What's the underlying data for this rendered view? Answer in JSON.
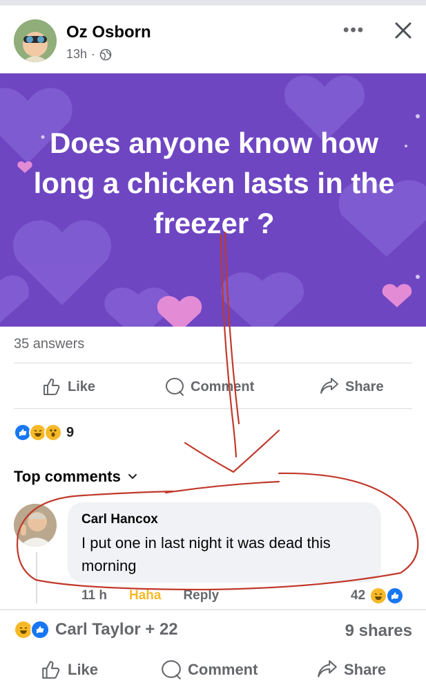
{
  "post": {
    "author": "Oz Osborn",
    "time": "13h",
    "separator": "·",
    "question": "Does anyone know how long a chicken lasts in the freezer ?",
    "answers": "35 answers"
  },
  "actions": {
    "like": "Like",
    "comment": "Comment",
    "share": "Share"
  },
  "reactions": {
    "count": "9",
    "types": [
      "like",
      "haha",
      "wow"
    ]
  },
  "top_comments_label": "Top comments",
  "comment": {
    "author": "Carl Hancox",
    "text": "I put one in last night it was dead this morning",
    "time": "11 h",
    "haha": "Haha",
    "reply": "Reply",
    "reaction_count": "42"
  },
  "footer": {
    "reactors": "Carl Taylor + 22",
    "shares": "9 shares",
    "like": "Like",
    "comment": "Comment",
    "share": "Share"
  },
  "colors": {
    "banner": "#6e46c2",
    "like_blue": "#1877f2",
    "haha_yellow": "#f7b928",
    "annotation_red": "#c0392b"
  },
  "icons": [
    "globe-icon",
    "more-icon",
    "close-icon",
    "thumbs-up-icon",
    "comment-icon",
    "share-icon",
    "chevron-down-icon"
  ]
}
